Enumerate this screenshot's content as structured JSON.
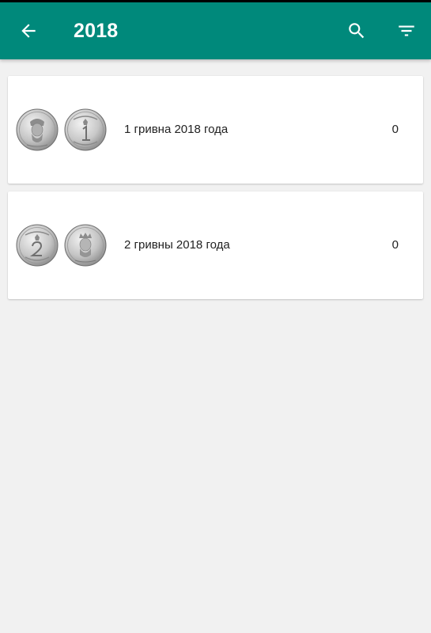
{
  "app_bar": {
    "title": "2018",
    "back_icon": "arrow-back-icon",
    "search_icon": "search-icon",
    "filter_icon": "filter-icon",
    "background_color": "#00897b",
    "text_color": "#ffffff"
  },
  "coins": [
    {
      "label": "1 гривна 2018 года",
      "count": "0",
      "obverse_icon": "coin-portrait-icon",
      "reverse_icon": "coin-denomination-1-icon"
    },
    {
      "label": "2 гривны 2018 года",
      "count": "0",
      "obverse_icon": "coin-denomination-2-icon",
      "reverse_icon": "coin-portrait-icon"
    }
  ]
}
